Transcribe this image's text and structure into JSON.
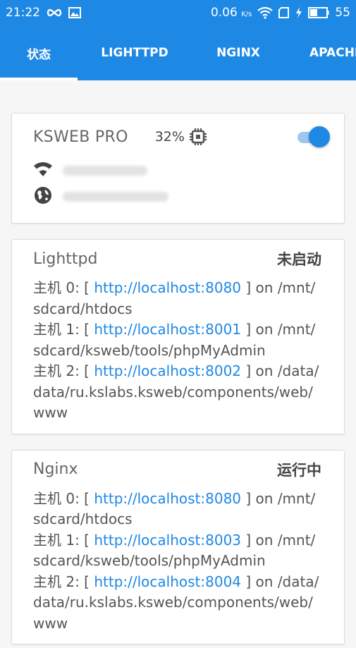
{
  "status_bar": {
    "time": "21:22",
    "speed": "0.06",
    "speed_unit": "K/s",
    "battery": "55"
  },
  "tabs": [
    {
      "label": "状态",
      "active": true
    },
    {
      "label": "LIGHTTPD",
      "active": false
    },
    {
      "label": "NGINX",
      "active": false
    },
    {
      "label": "APACHE",
      "active": false
    }
  ],
  "kweb": {
    "title": "KSWEB PRO",
    "cpu_percent": "32%",
    "toggle_on": true
  },
  "servers": [
    {
      "name": "Lighttpd",
      "state": "未启动",
      "hosts": [
        {
          "prefix": "主机 0: [ ",
          "url": "http://localhost:8080",
          "suffix": " ] on /mnt/sdcard/htdocs"
        },
        {
          "prefix": "主机 1: [ ",
          "url": "http://localhost:8001",
          "suffix": " ] on /mnt/sdcard/ksweb/tools/phpMyAdmin"
        },
        {
          "prefix": "主机 2: [ ",
          "url": "http://localhost:8002",
          "suffix": " ] on /data/data/ru.kslabs.ksweb/components/web/www"
        }
      ]
    },
    {
      "name": "Nginx",
      "state": "运行中",
      "hosts": [
        {
          "prefix": "主机 0: [ ",
          "url": "http://localhost:8080",
          "suffix": " ] on /mnt/sdcard/htdocs"
        },
        {
          "prefix": "主机 1: [ ",
          "url": "http://localhost:8003",
          "suffix": " ] on /mnt/sdcard/ksweb/tools/phpMyAdmin"
        },
        {
          "prefix": "主机 2: [ ",
          "url": "http://localhost:8004",
          "suffix": " ] on /data/data/ru.kslabs.ksweb/components/web/www"
        }
      ]
    }
  ],
  "colors": {
    "primary": "#1e88e5"
  }
}
